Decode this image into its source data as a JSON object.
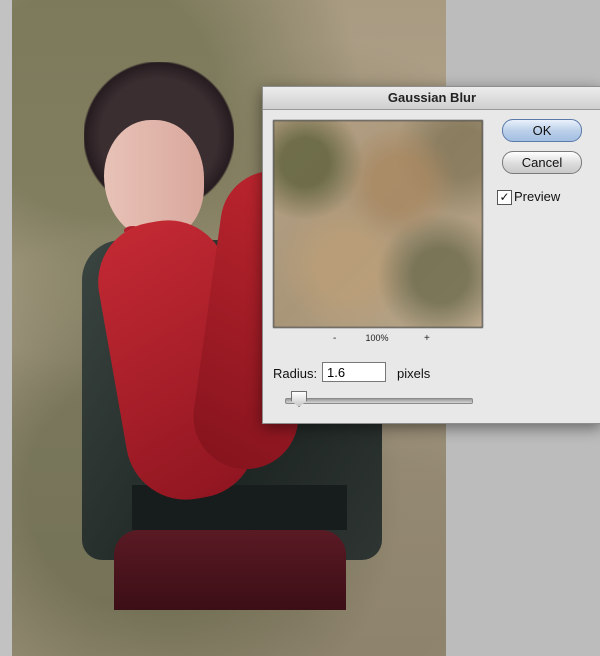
{
  "dialog": {
    "title": "Gaussian Blur",
    "ok_label": "OK",
    "cancel_label": "Cancel",
    "preview": {
      "label": "Preview",
      "checked": true,
      "check_glyph": "✓"
    },
    "zoom": {
      "minus_label": "-",
      "level": "100%",
      "plus_label": "+"
    },
    "radius": {
      "label": "Radius:",
      "value": "1.6",
      "unit": "pixels",
      "slider_fraction": 0.07
    }
  },
  "icons": {
    "checkbox": "check-icon"
  },
  "colors": {
    "default_button": "#a3bfe3",
    "dialog_background": "#e8e8e8"
  }
}
